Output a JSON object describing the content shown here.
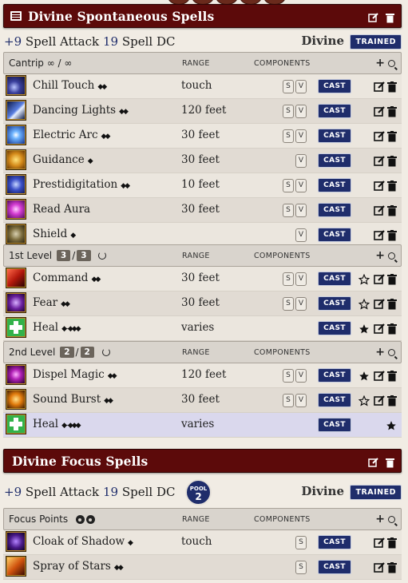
{
  "sections": {
    "spontaneous": {
      "title": "Divine Spontaneous Spells",
      "spell_attack_mod": "+9",
      "spell_attack_label": "Spell Attack",
      "spell_dc_value": "19",
      "spell_dc_label": "Spell DC",
      "tradition": "Divine",
      "proficiency": "TRAINED"
    },
    "focus": {
      "title": "Divine Focus Spells",
      "spell_attack_mod": "+9",
      "spell_attack_label": "Spell Attack",
      "spell_dc_value": "19",
      "spell_dc_label": "Spell DC",
      "pool_label": "POOL",
      "pool_value": "2",
      "tradition": "Divine",
      "proficiency": "TRAINED"
    }
  },
  "columns": {
    "range": "RANGE",
    "components": "COMPONENTS"
  },
  "cast_label": "CAST",
  "cantrip": {
    "label": "Cantrip ∞ / ∞",
    "rows": [
      {
        "name": "Chill Touch",
        "actions": "◆◆",
        "range": "touch",
        "s": "S",
        "v": "V"
      },
      {
        "name": "Dancing Lights",
        "actions": "◆◆",
        "range": "120 feet",
        "s": "S",
        "v": "V"
      },
      {
        "name": "Electric Arc",
        "actions": "◆◆",
        "range": "30 feet",
        "s": "S",
        "v": "V"
      },
      {
        "name": "Guidance",
        "actions": "◆",
        "range": "30 feet",
        "v": "V"
      },
      {
        "name": "Prestidigitation",
        "actions": "◆◆",
        "range": "10 feet",
        "s": "S",
        "v": "V"
      },
      {
        "name": "Read Aura",
        "actions": "",
        "range": "30 feet",
        "s": "S",
        "v": "V"
      },
      {
        "name": "Shield",
        "actions": "◆",
        "range": "",
        "v": "V"
      }
    ]
  },
  "level1": {
    "label": "1st Level",
    "slots_current": "3",
    "slot_sep": "/",
    "slots_max": "3",
    "rows": [
      {
        "name": "Command",
        "actions": "◆◆",
        "range": "30 feet",
        "s": "S",
        "v": "V",
        "star": "empty"
      },
      {
        "name": "Fear",
        "actions": "◆◆",
        "range": "30 feet",
        "s": "S",
        "v": "V",
        "star": "empty"
      },
      {
        "name": "Heal",
        "actions": "◆ - ◆◆◆",
        "range": "varies",
        "star": "filled"
      }
    ]
  },
  "level2": {
    "label": "2nd Level",
    "slots_current": "2",
    "slot_sep": "/",
    "slots_max": "2",
    "rows": [
      {
        "name": "Dispel Magic",
        "actions": "◆◆",
        "range": "120 feet",
        "s": "S",
        "v": "V",
        "star": "filled"
      },
      {
        "name": "Sound Burst",
        "actions": "◆◆",
        "range": "30 feet",
        "s": "S",
        "v": "V",
        "star": "empty"
      },
      {
        "name": "Heal",
        "actions": "◆ - ◆◆◆",
        "range": "varies",
        "star": "filled"
      }
    ]
  },
  "focus_table": {
    "label": "Focus Points",
    "points": 2,
    "rows": [
      {
        "name": "Cloak of Shadow",
        "actions": "◆",
        "range": "touch",
        "s": "S"
      },
      {
        "name": "Spray of Stars",
        "actions": "◆◆",
        "range": "",
        "s": "S"
      }
    ]
  },
  "colors": {
    "header": "#5c0a0a",
    "accent": "#1f2d6b",
    "gold": "#b88a2c"
  },
  "icons": [
    "list-icon",
    "edit-icon",
    "trash-icon",
    "star-icon",
    "star-outline-icon",
    "plus-icon",
    "search-icon",
    "refresh-icon"
  ]
}
